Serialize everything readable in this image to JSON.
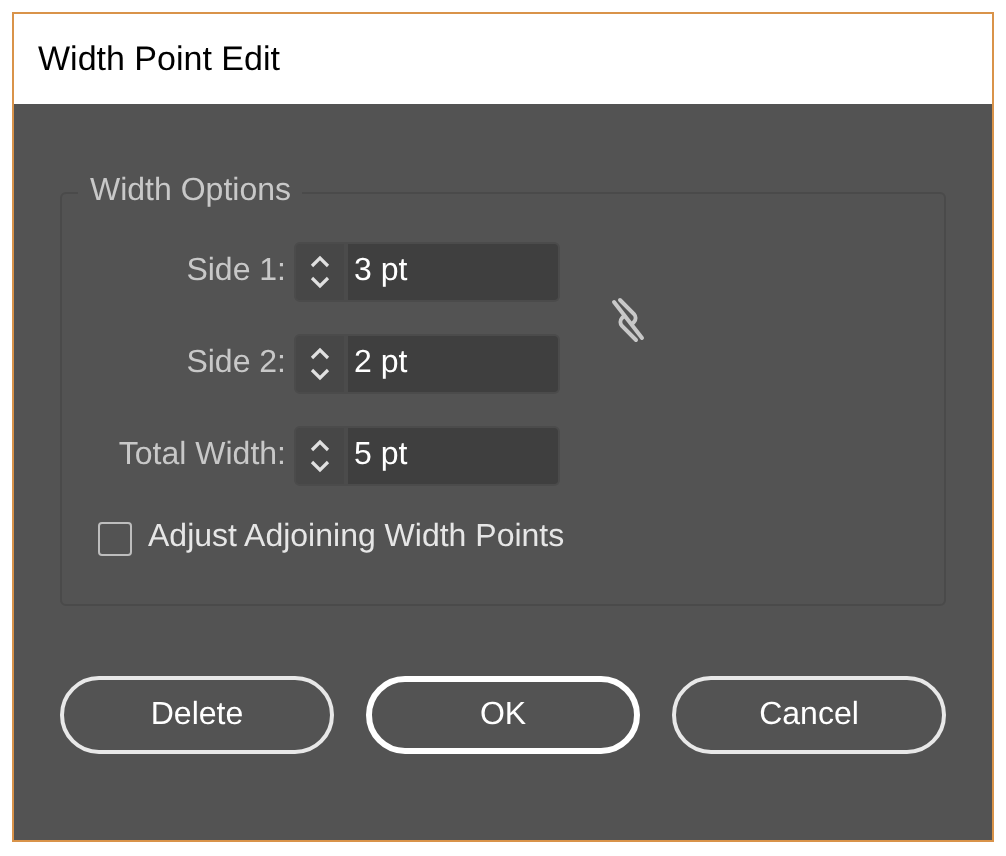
{
  "window": {
    "title": "Width Point Edit"
  },
  "group": {
    "title": "Width Options",
    "fields": [
      {
        "label": "Side 1:",
        "value": "3 pt"
      },
      {
        "label": "Side 2:",
        "value": "2 pt"
      },
      {
        "label": "Total Width:",
        "value": "5 pt"
      }
    ],
    "link_widths": {
      "linked": false
    },
    "checkbox": {
      "label": "Adjust Adjoining Width Points",
      "checked": false
    }
  },
  "buttons": [
    {
      "label": "Delete",
      "default": false
    },
    {
      "label": "OK",
      "default": true
    },
    {
      "label": "Cancel",
      "default": false
    }
  ]
}
